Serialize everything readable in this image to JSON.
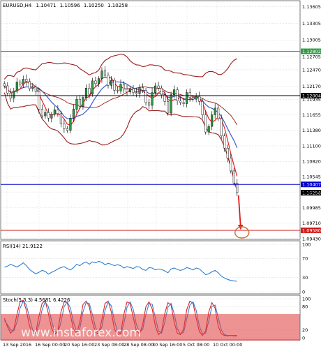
{
  "chart_data": {
    "type": "candlestick",
    "symbol_label": "EURUSD,H4",
    "ohlc": {
      "open": "1.10471",
      "high": "1.10596",
      "low": "1.10250",
      "close": "1.10258"
    },
    "price_axis": {
      "ylim": [
        1.0943,
        1.1365
      ],
      "ticks": [
        "1.13605",
        "1.13305",
        "1.13005",
        "1.12705",
        "1.12470",
        "1.12170",
        "1.11935",
        "1.11655",
        "1.11380",
        "1.11100",
        "1.10820",
        "1.10545",
        "1.10270",
        "1.09985",
        "1.09710",
        "1.09430"
      ]
    },
    "x_ticks": [
      "13 Sep 2016",
      "16 Sep 00:00",
      "20 Sep 16:00",
      "23 Sep 08:00",
      "28 Sep 08:00",
      "30 Sep 16:00",
      "5 Oct 08:00",
      "10 Oct 00:00"
    ],
    "levels": [
      {
        "name": "resistance-upper",
        "value": 1.12802,
        "label": "1.12802",
        "color": "#2e9a44"
      },
      {
        "name": "resistance-mid",
        "value": 1.12004,
        "label": "1.12004",
        "color": "#000000"
      },
      {
        "name": "support-current",
        "value": 1.10407,
        "label": "1.10407",
        "color": "#0000cc"
      },
      {
        "name": "target",
        "value": 1.0958,
        "label": "1.09580",
        "color": "#d21a1a"
      }
    ],
    "current_price_label": "1.10258",
    "close_series": [
      1.1218,
      1.1205,
      1.1196,
      1.1209,
      1.1225,
      1.1221,
      1.123,
      1.1226,
      1.1213,
      1.1216,
      1.1208,
      1.1176,
      1.1164,
      1.117,
      1.116,
      1.1167,
      1.1175,
      1.1168,
      1.115,
      1.1141,
      1.1138,
      1.116,
      1.1176,
      1.1194,
      1.1181,
      1.1197,
      1.1214,
      1.1203,
      1.1227,
      1.1222,
      1.1231,
      1.1245,
      1.1237,
      1.1219,
      1.1228,
      1.121,
      1.1209,
      1.1221,
      1.1212,
      1.1207,
      1.1213,
      1.1206,
      1.1204,
      1.1215,
      1.121,
      1.1188,
      1.1183,
      1.1206,
      1.1218,
      1.1214,
      1.1202,
      1.119,
      1.1169,
      1.1202,
      1.1211,
      1.1191,
      1.1188,
      1.1186,
      1.1206,
      1.1197,
      1.1194,
      1.1199,
      1.119,
      1.1166,
      1.1135,
      1.1145,
      1.1166,
      1.1178,
      1.1159,
      1.1128,
      1.1106,
      1.1088,
      1.1065,
      1.1043,
      1.1026
    ],
    "rsi": {
      "label": "RSI(14) 21.9122",
      "ylim": [
        0,
        100
      ],
      "ticks": [
        "100",
        "70",
        "30",
        "0"
      ],
      "values": [
        52,
        54,
        58,
        55,
        52,
        56,
        61,
        55,
        47,
        42,
        38,
        41,
        45,
        43,
        37,
        41,
        44,
        48,
        51,
        53,
        49,
        46,
        51,
        58,
        55,
        60,
        63,
        58,
        63,
        61,
        64,
        62,
        57,
        60,
        58,
        55,
        57,
        55,
        50,
        53,
        51,
        49,
        53,
        52,
        47,
        45,
        51,
        50,
        46,
        48,
        47,
        44,
        40,
        48,
        50,
        47,
        45,
        47,
        51,
        49,
        46,
        50,
        48,
        42,
        36,
        38,
        42,
        45,
        40,
        33,
        29,
        26,
        24,
        23,
        22
      ]
    },
    "stochastic": {
      "label": "Stoch(5,3,3) 4.5681 6.4226",
      "ylim": [
        0,
        100
      ],
      "ticks": [
        "100",
        "80",
        "20",
        "0"
      ],
      "main": [
        50,
        28,
        12,
        22,
        60,
        92,
        96,
        70,
        30,
        10,
        14,
        55,
        88,
        95,
        62,
        25,
        8,
        18,
        66,
        92,
        90,
        58,
        22,
        12,
        40,
        85,
        94,
        80,
        40,
        14,
        10,
        46,
        88,
        94,
        66,
        22,
        8,
        12,
        60,
        92,
        88,
        52,
        18,
        10,
        34,
        80,
        92,
        74,
        30,
        8,
        16,
        62,
        90,
        84,
        40,
        12,
        8,
        22,
        72,
        94,
        88,
        50,
        16,
        6,
        18,
        66,
        90,
        76,
        30,
        10,
        6,
        5,
        6,
        5,
        5
      ],
      "signal": [
        44,
        34,
        20,
        18,
        40,
        76,
        94,
        84,
        52,
        20,
        12,
        32,
        72,
        92,
        80,
        44,
        16,
        12,
        40,
        80,
        92,
        76,
        40,
        16,
        24,
        66,
        90,
        88,
        60,
        26,
        12,
        28,
        70,
        92,
        82,
        44,
        16,
        10,
        36,
        78,
        92,
        72,
        34,
        14,
        22,
        60,
        88,
        86,
        52,
        18,
        12,
        40,
        78,
        88,
        62,
        24,
        10,
        14,
        48,
        84,
        92,
        70,
        30,
        10,
        12,
        44,
        80,
        84,
        52,
        20,
        8,
        6,
        6,
        6,
        6
      ]
    },
    "projection": {
      "from": 1.1026,
      "to": 1.0958,
      "target_label": "1.09580"
    }
  },
  "watermark": {
    "text": "www.instaforex.com"
  },
  "colors": {
    "bb": "#9b1c1c",
    "ma": "#3c5dc8",
    "fast": "#e52222",
    "rsi": "#2f7fd3",
    "stoch_main": "#dd2222",
    "stoch_signal": "#3a7fd8",
    "grid": "#c9c9c9"
  }
}
